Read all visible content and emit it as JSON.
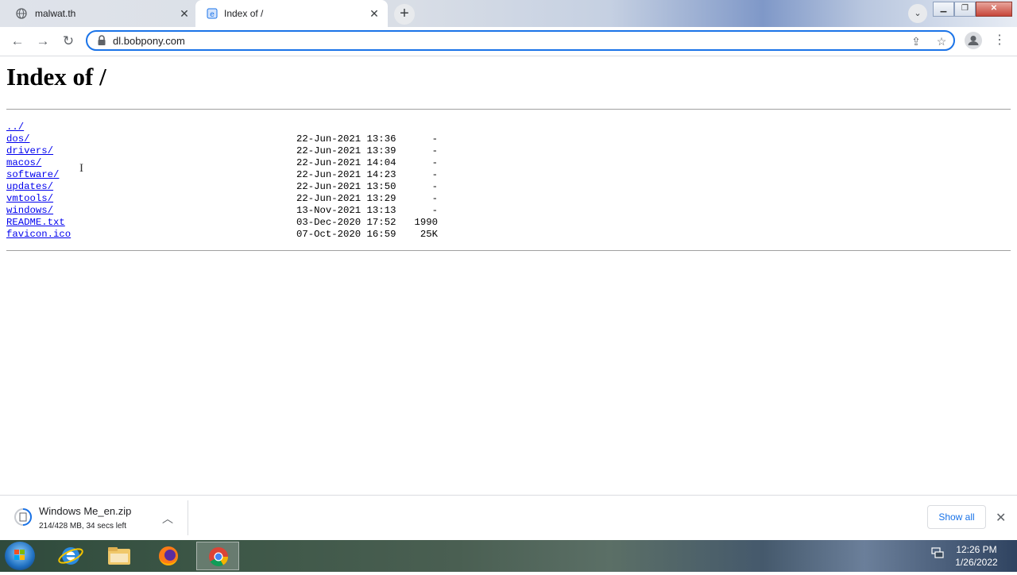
{
  "browser": {
    "tabs": [
      {
        "title": "malwat.th",
        "active": false
      },
      {
        "title": "Index of /",
        "active": true
      }
    ],
    "url": "dl.bobpony.com"
  },
  "page": {
    "heading": "Index of /",
    "entries": [
      {
        "name": "../",
        "date": "",
        "size": ""
      },
      {
        "name": "dos/",
        "date": "22-Jun-2021 13:36",
        "size": "-"
      },
      {
        "name": "drivers/",
        "date": "22-Jun-2021 13:39",
        "size": "-"
      },
      {
        "name": "macos/",
        "date": "22-Jun-2021 14:04",
        "size": "-"
      },
      {
        "name": "software/",
        "date": "22-Jun-2021 14:23",
        "size": "-"
      },
      {
        "name": "updates/",
        "date": "22-Jun-2021 13:50",
        "size": "-"
      },
      {
        "name": "vmtools/",
        "date": "22-Jun-2021 13:29",
        "size": "-"
      },
      {
        "name": "windows/",
        "date": "13-Nov-2021 13:13",
        "size": "-"
      },
      {
        "name": "README.txt",
        "date": "03-Dec-2020 17:52",
        "size": "1990"
      },
      {
        "name": "favicon.ico",
        "date": "07-Oct-2020 16:59",
        "size": "25K"
      }
    ]
  },
  "download": {
    "filename": "Windows Me_en.zip",
    "status": "214/428 MB, 34 secs left",
    "show_all_label": "Show all"
  },
  "taskbar": {
    "apps": [
      "internet-explorer",
      "file-explorer",
      "firefox",
      "chrome"
    ],
    "active_app": "chrome",
    "time": "12:26 PM",
    "date": "1/26/2022"
  },
  "colors": {
    "link": "#0000ee",
    "accent": "#1a73e8"
  }
}
